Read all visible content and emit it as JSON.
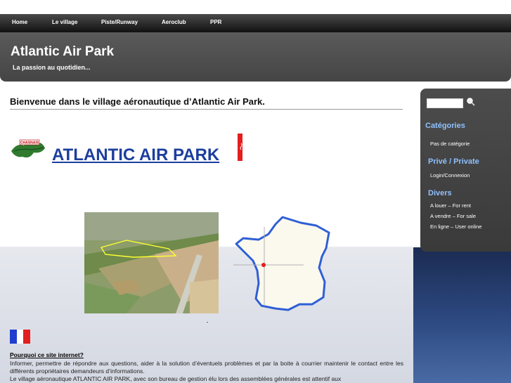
{
  "nav": {
    "items": [
      "Home",
      "Le village",
      "Piste/Runway",
      "Aeroclub",
      "PPR"
    ]
  },
  "header": {
    "title": "Atlantic Air Park",
    "tagline": "La passion au quotidien..."
  },
  "main": {
    "title": "Bienvenue dans le village aéronautique d’Atlantic Air Park.",
    "logo_text": "CHASNAIS",
    "brand": "ATLANTIC AIR PARK",
    "why_heading": "Pourquoi ce site internet?",
    "why_lines": [
      "Informer, permettre de répondre aux questions, aider à la solution d’éventuels problèmes et par la boite à courrier maintenir le contact entre les différents propriétaires demandeurs d’informations.",
      "Le village aéronautique ATLANTIC AIR PARK, avec son bureau de gestion élu lors des assemblées générales est attentif aux"
    ]
  },
  "sidebar": {
    "search_placeholder": "",
    "categories_heading": "Catégories",
    "categories_item": "Pas de catégorie",
    "private_heading": "Privé / Private",
    "login_label": "Login/Connexion",
    "divers_heading": "Divers",
    "divers_items": [
      "A louer – For rent",
      "A vendre – For sale",
      "En ligne – User online"
    ]
  },
  "colors": {
    "brand_blue": "#1c3f9e",
    "sidebar_heading": "#8fc0ff",
    "flag_blue": "#1f3fcf",
    "flag_red": "#e21e1e"
  }
}
